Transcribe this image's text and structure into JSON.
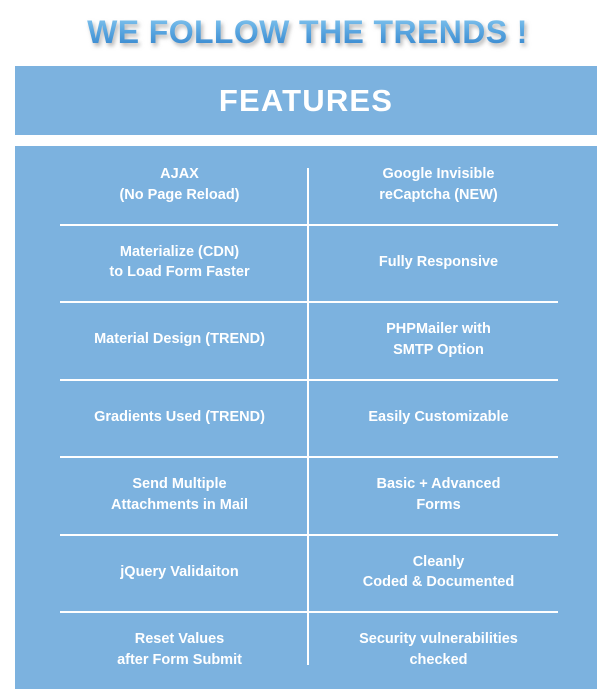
{
  "headline": "WE FOLLOW THE TRENDS !",
  "features_bar": {
    "label": "FEATURES"
  },
  "colors": {
    "panel_blue": "#7CB2DF",
    "divider_white": "#FFFFFF",
    "page_background": "#FFFFFF",
    "headline_gradient_top": "#8CCBF0",
    "headline_gradient_bottom": "#2E80CA"
  },
  "feature_rows": [
    {
      "left": [
        "AJAX",
        "(No Page Reload)"
      ],
      "right": [
        "Google Invisible",
        "reCaptcha (NEW)"
      ]
    },
    {
      "left": [
        "Materialize (CDN)",
        "to Load Form Faster"
      ],
      "right": [
        "Fully Responsive"
      ]
    },
    {
      "left": [
        "Material Design (TREND)"
      ],
      "right": [
        "PHPMailer with",
        "SMTP Option"
      ]
    },
    {
      "left": [
        "Gradients Used (TREND)"
      ],
      "right": [
        "Easily Customizable"
      ]
    },
    {
      "left": [
        "Send Multiple",
        "Attachments in Mail"
      ],
      "right": [
        "Basic + Advanced",
        "Forms"
      ]
    },
    {
      "left": [
        "jQuery Validaiton"
      ],
      "right": [
        "Cleanly",
        "Coded & Documented"
      ]
    },
    {
      "left": [
        "Reset Values",
        "after Form Submit"
      ],
      "right": [
        "Security vulnerabilities",
        "checked"
      ]
    }
  ]
}
